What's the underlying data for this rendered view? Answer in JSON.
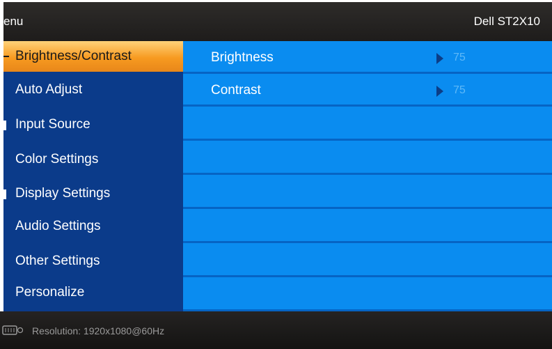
{
  "header": {
    "title": "enu",
    "model": "Dell ST2X10"
  },
  "sidebar": {
    "items": [
      {
        "label": "Brightness/Contrast",
        "active": true
      },
      {
        "label": "Auto Adjust"
      },
      {
        "label": "Input Source"
      },
      {
        "label": "Color Settings"
      },
      {
        "label": "Display Settings"
      },
      {
        "label": "Audio Settings"
      },
      {
        "label": "Other Settings"
      },
      {
        "label": "Personalize"
      }
    ]
  },
  "content": {
    "rows": [
      {
        "label": "Brightness",
        "value": "75"
      },
      {
        "label": "Contrast",
        "value": "75"
      }
    ]
  },
  "footer": {
    "resolution": "Resolution:  1920x1080@60Hz",
    "icon": "video-port-icon"
  },
  "colors": {
    "header_bg": "#262423",
    "sidebar_bg": "#0b3b8a",
    "content_bg": "#0a8cf0",
    "active_item": "#f79a20",
    "value_text": "#5fb9f8"
  }
}
